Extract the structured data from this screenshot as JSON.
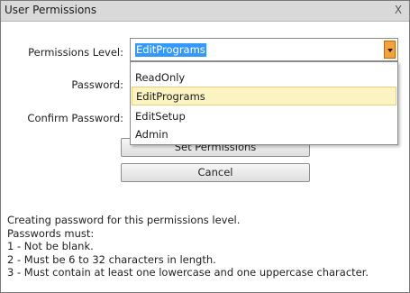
{
  "window": {
    "title": "User Permissions",
    "close_label": "X"
  },
  "form": {
    "permissions_level_label": "Permissions Level:",
    "password_label": "Password:",
    "confirm_password_label": "Confirm Password:",
    "permissions_level_value": "EditPrograms"
  },
  "dropdown": {
    "options": [
      "ReadOnly",
      "EditPrograms",
      "EditSetup",
      "Admin"
    ],
    "highlighted": "EditPrograms"
  },
  "buttons": {
    "set_permissions": "Set Permissions",
    "cancel": "Cancel"
  },
  "info": {
    "lines": [
      "Creating password for this permissions level.",
      "Passwords must:",
      "1 - Not be blank.",
      "2 - Must be 6 to 32 characters in length.",
      "3 - Must contain at least one lowercase and one uppercase character."
    ]
  },
  "colors": {
    "selection": "#3399ff",
    "dropdown_highlight": "#fbf3c1",
    "combo_arrow": "#f5a23a"
  }
}
